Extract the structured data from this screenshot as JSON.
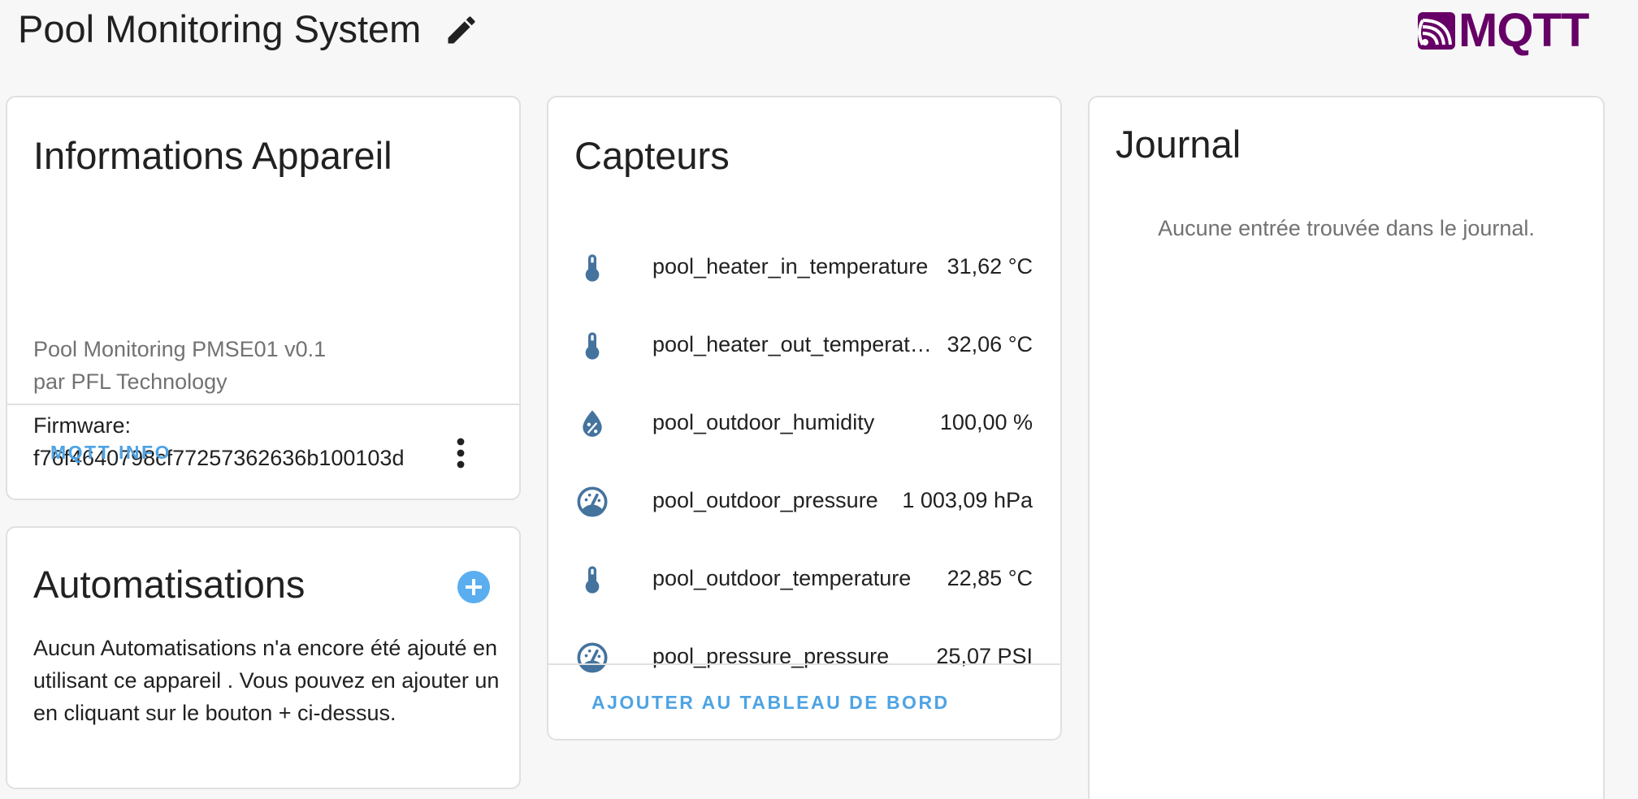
{
  "header": {
    "title": "Pool Monitoring System",
    "brand": "MQTT"
  },
  "device_card": {
    "title": "Informations Appareil",
    "model": "Pool Monitoring PMSE01 v0.1",
    "manufacturer": "par PFL Technology",
    "firmware_label": "Firmware:",
    "firmware_value": "f76f4640798cf77257362636b100103d",
    "action_label": "MQTT INFO"
  },
  "automations_card": {
    "title": "Automatisations",
    "empty_text": "Aucun Automatisations n'a encore été ajouté en utilisant ce appareil . Vous pouvez en ajouter un en cliquant sur le bouton + ci-dessus."
  },
  "sensors_card": {
    "title": "Capteurs",
    "items": [
      {
        "icon": "thermometer-icon",
        "name": "pool_heater_in_temperature",
        "value": "31,62 °C"
      },
      {
        "icon": "thermometer-icon",
        "name": "pool_heater_out_temperature",
        "value": "32,06 °C"
      },
      {
        "icon": "water-percent-icon",
        "name": "pool_outdoor_humidity",
        "value": "100,00 %"
      },
      {
        "icon": "gauge-icon",
        "name": "pool_outdoor_pressure",
        "value": "1 003,09 hPa"
      },
      {
        "icon": "thermometer-icon",
        "name": "pool_outdoor_temperature",
        "value": "22,85 °C"
      },
      {
        "icon": "gauge-icon",
        "name": "pool_pressure_pressure",
        "value": "25,07 PSI"
      }
    ],
    "action_label": "AJOUTER AU TABLEAU DE BORD"
  },
  "journal_card": {
    "title": "Journal",
    "empty_text": "Aucune entrée trouvée dans le journal."
  },
  "colors": {
    "accent": "#4ea3e4",
    "icon": "#44739e",
    "brand": "#660066"
  }
}
